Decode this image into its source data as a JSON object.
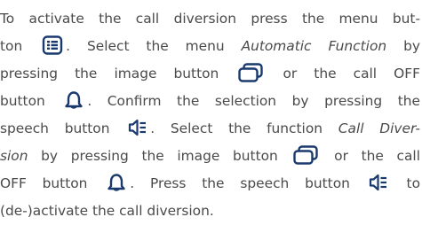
{
  "paragraph": {
    "l1": "To activate the call diversion press the menu but-",
    "l2a": "ton",
    "l2b": ". Select the menu",
    "l2c": "Automatic Function",
    "l2d": "by",
    "l3a": "pressing the image button",
    "l3b": "or the call OFF",
    "l4a": "button",
    "l4b": ". Confirm the selection by pressing the",
    "l5a": "speech button",
    "l5b": ". Select the function",
    "l5c": "Call Diver-",
    "l6a": "sion",
    "l6b": "by pressing the image button",
    "l6c": "or the call",
    "l7a": "OFF button",
    "l7b": ". Press the speech button",
    "l7c": "to",
    "l8": "(de-)activate the call diversion."
  },
  "icons": {
    "menu": "menu-list-icon",
    "image": "image-button-icon",
    "bell": "call-off-bell-icon",
    "speech": "speech-button-icon",
    "color": "#1a3a6e"
  }
}
